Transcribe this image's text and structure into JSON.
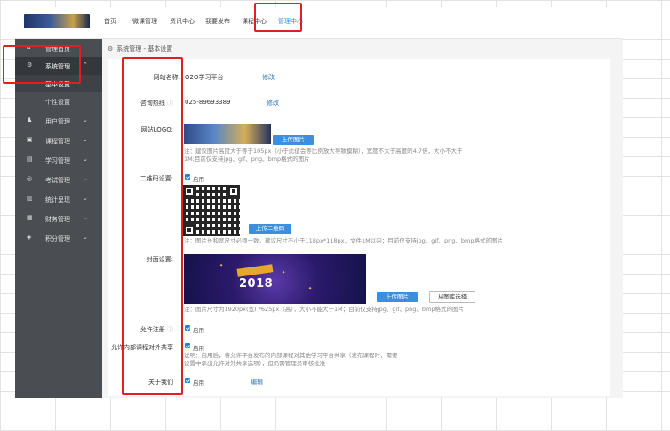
{
  "top_nav": {
    "items": [
      "首页",
      "微课管理",
      "资讯中心",
      "我要发布",
      "课程中心",
      "管理中心"
    ],
    "active_index": 5
  },
  "sidebar": {
    "items": [
      {
        "label": "管理首页",
        "icon": "home-icon"
      },
      {
        "label": "系统管理",
        "icon": "gear-icon",
        "active": true
      },
      {
        "label": "用户管理",
        "icon": "user-icon"
      },
      {
        "label": "课程管理",
        "icon": "course-icon"
      },
      {
        "label": "学习管理",
        "icon": "study-icon"
      },
      {
        "label": "考试管理",
        "icon": "exam-icon"
      },
      {
        "label": "统计呈现",
        "icon": "chart-icon"
      },
      {
        "label": "财务管理",
        "icon": "finance-icon"
      },
      {
        "label": "积分管理",
        "icon": "points-icon"
      }
    ],
    "sub_items": [
      {
        "label": "基本设置",
        "active": true
      },
      {
        "label": "个性设置"
      }
    ]
  },
  "breadcrumb": "系统管理 - 基本设置",
  "form": {
    "site_name": {
      "label": "网站名称:",
      "value": "O2O学习平台",
      "action": "修改"
    },
    "hotline": {
      "label": "咨询热线",
      "value": "025-89693389",
      "action": "修改"
    },
    "logo": {
      "label": "网站LOGO:",
      "button": "上传图片",
      "tip": [
        "注：建议图片高度大于等于105px（小于此值会等比例放大导致模糊），宽度不大于高度的4.7倍，大小不大于",
        "1M;目前仅支持jpg、gif、png、bmp格式的图片"
      ]
    },
    "qrcode": {
      "label": "二维码设置:",
      "checkbox": "启用",
      "button": "上传二维码",
      "tip": "注：图片长和宽尺寸必须一致，建议尺寸不小于118px*118px，文件1M以内；目前仅支持jpg、gif、png、bmp格式的图片"
    },
    "cover": {
      "label": "封面设置:",
      "cover_text": "2018",
      "upload_button": "上传图片",
      "library_button": "从图库选择",
      "tip": "注：图片尺寸为1920px(宽) *625px（高），大小不能大于1M；目前仅支持jpg、gif、png、bmp格式的图片"
    },
    "allow_register": {
      "label": "允许注册",
      "checkbox": "启用"
    },
    "course_share": {
      "label": "允许内部课程对外共享",
      "checkbox": "启用",
      "tip": [
        "说明：启用后，将允许平台发布的内部课程对其他学习平台共享（发布课程时，需要",
        "设置中承出允许对外共享选项），但仍需管理员审核批准"
      ]
    },
    "about": {
      "label": "关于我们",
      "checkbox": "启用",
      "action": "编辑"
    }
  },
  "colors": {
    "highlight": "#e02020",
    "accent": "#2f8ad6",
    "sidebar": "#4a4d52"
  }
}
